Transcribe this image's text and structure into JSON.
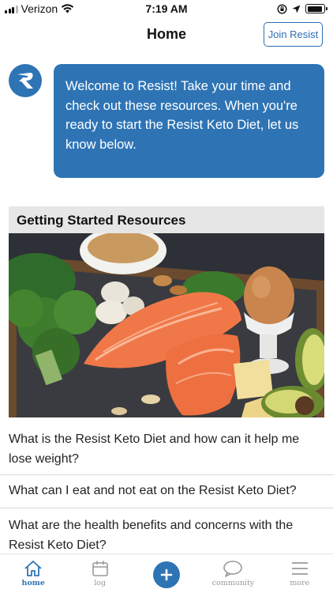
{
  "status_bar": {
    "carrier": "Verizon",
    "time": "7:19 AM",
    "battery_level": 0.9
  },
  "nav": {
    "title": "Home",
    "join_button": "Join Resist"
  },
  "welcome": {
    "message": "Welcome to Resist! Take your time and check out these resources. When you're ready to start the Resist Keto Diet, let us know below."
  },
  "resources": {
    "header": "Getting Started Resources",
    "items": [
      {
        "label": "What is the Resist Keto Diet and how can it help me lose weight?"
      },
      {
        "label": "What can I eat and not eat on the Resist Keto Diet?"
      },
      {
        "label": "What are the health benefits and concerns with the Resist Keto Diet?"
      }
    ]
  },
  "tabs": [
    {
      "label": "home",
      "icon": "home-icon",
      "active": true
    },
    {
      "label": "log",
      "icon": "calendar-icon",
      "active": false
    },
    {
      "label": "",
      "icon": "plus-icon",
      "active": false
    },
    {
      "label": "community",
      "icon": "chat-bubble-icon",
      "active": false
    },
    {
      "label": "more",
      "icon": "menu-icon",
      "active": false
    }
  ],
  "colors": {
    "accent": "#2e74b5",
    "inactive": "#9a9a9a",
    "header_bg": "#e6e6e6"
  }
}
